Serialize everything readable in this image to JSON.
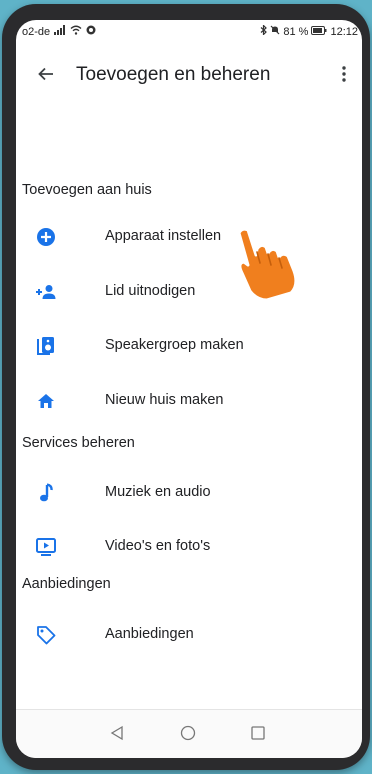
{
  "status": {
    "carrier": "o2-de",
    "battery": "81 %",
    "time": "12:12"
  },
  "header": {
    "title": "Toevoegen en beheren"
  },
  "sections": [
    {
      "heading": "Toevoegen aan huis",
      "items": [
        {
          "label": "Apparaat instellen",
          "icon": "add-circle-icon"
        },
        {
          "label": "Lid uitnodigen",
          "icon": "person-add-icon"
        },
        {
          "label": "Speakergroep maken",
          "icon": "speaker-group-icon"
        },
        {
          "label": "Nieuw huis maken",
          "icon": "home-icon"
        }
      ]
    },
    {
      "heading": "Services beheren",
      "items": [
        {
          "label": "Muziek en audio",
          "icon": "music-note-icon"
        },
        {
          "label": "Video's en foto's",
          "icon": "video-icon"
        }
      ]
    },
    {
      "heading": "Aanbiedingen",
      "items": [
        {
          "label": "Aanbiedingen",
          "icon": "tag-icon"
        }
      ]
    }
  ],
  "colors": {
    "accent": "#1a73e8",
    "pointer": "#f07f1e",
    "background": "#5fb3c8"
  }
}
